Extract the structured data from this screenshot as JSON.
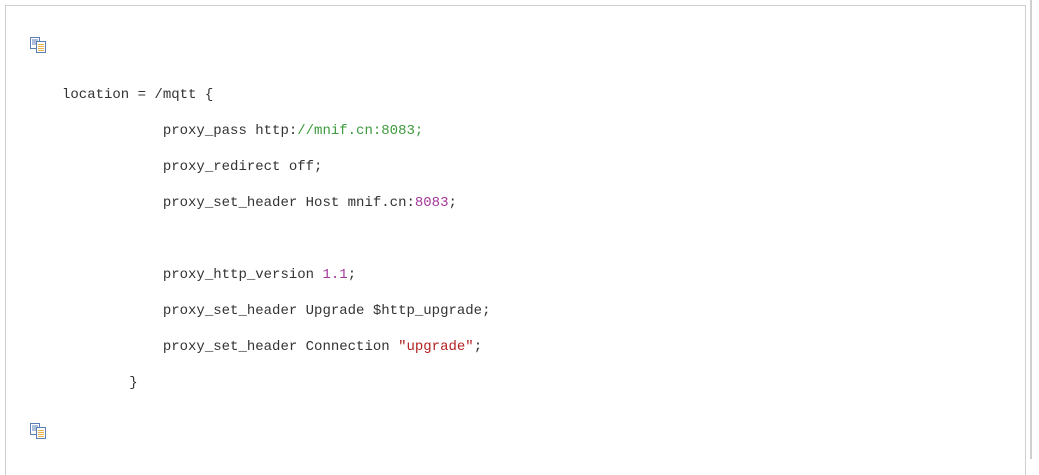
{
  "copy_buttons": {
    "top_icon": "copy-icon",
    "bottom_icon": "copy-icon"
  },
  "code": {
    "lines": [
      {
        "indent": "",
        "segments": [
          {
            "text": "location = /mqtt {",
            "style": "plain"
          }
        ]
      },
      {
        "indent": "            ",
        "segments": [
          {
            "text": "proxy_pass http:",
            "style": "plain"
          },
          {
            "text": "//mnif.cn:8083;",
            "style": "green"
          }
        ]
      },
      {
        "indent": "            ",
        "segments": [
          {
            "text": "proxy_redirect off;",
            "style": "plain"
          }
        ]
      },
      {
        "indent": "            ",
        "segments": [
          {
            "text": "proxy_set_header Host mnif.cn:",
            "style": "plain"
          },
          {
            "text": "8083",
            "style": "number"
          },
          {
            "text": ";",
            "style": "plain"
          }
        ]
      },
      {
        "indent": "",
        "segments": [
          {
            "text": "",
            "style": "plain"
          }
        ]
      },
      {
        "indent": "            ",
        "segments": [
          {
            "text": "proxy_http_version ",
            "style": "plain"
          },
          {
            "text": "1.1",
            "style": "number"
          },
          {
            "text": ";",
            "style": "plain"
          }
        ]
      },
      {
        "indent": "            ",
        "segments": [
          {
            "text": "proxy_set_header Upgrade $http_upgrade;",
            "style": "plain"
          }
        ]
      },
      {
        "indent": "            ",
        "segments": [
          {
            "text": "proxy_set_header Connection ",
            "style": "plain"
          },
          {
            "text": "\"upgrade\"",
            "style": "string"
          },
          {
            "text": ";",
            "style": "plain"
          }
        ]
      },
      {
        "indent": "        ",
        "segments": [
          {
            "text": "}",
            "style": "plain"
          }
        ]
      }
    ]
  },
  "colors": {
    "text": "#333333",
    "green": "#3d9a3d",
    "number": "#a3389a",
    "string": "#b22222",
    "border": "#cfcfcf"
  }
}
